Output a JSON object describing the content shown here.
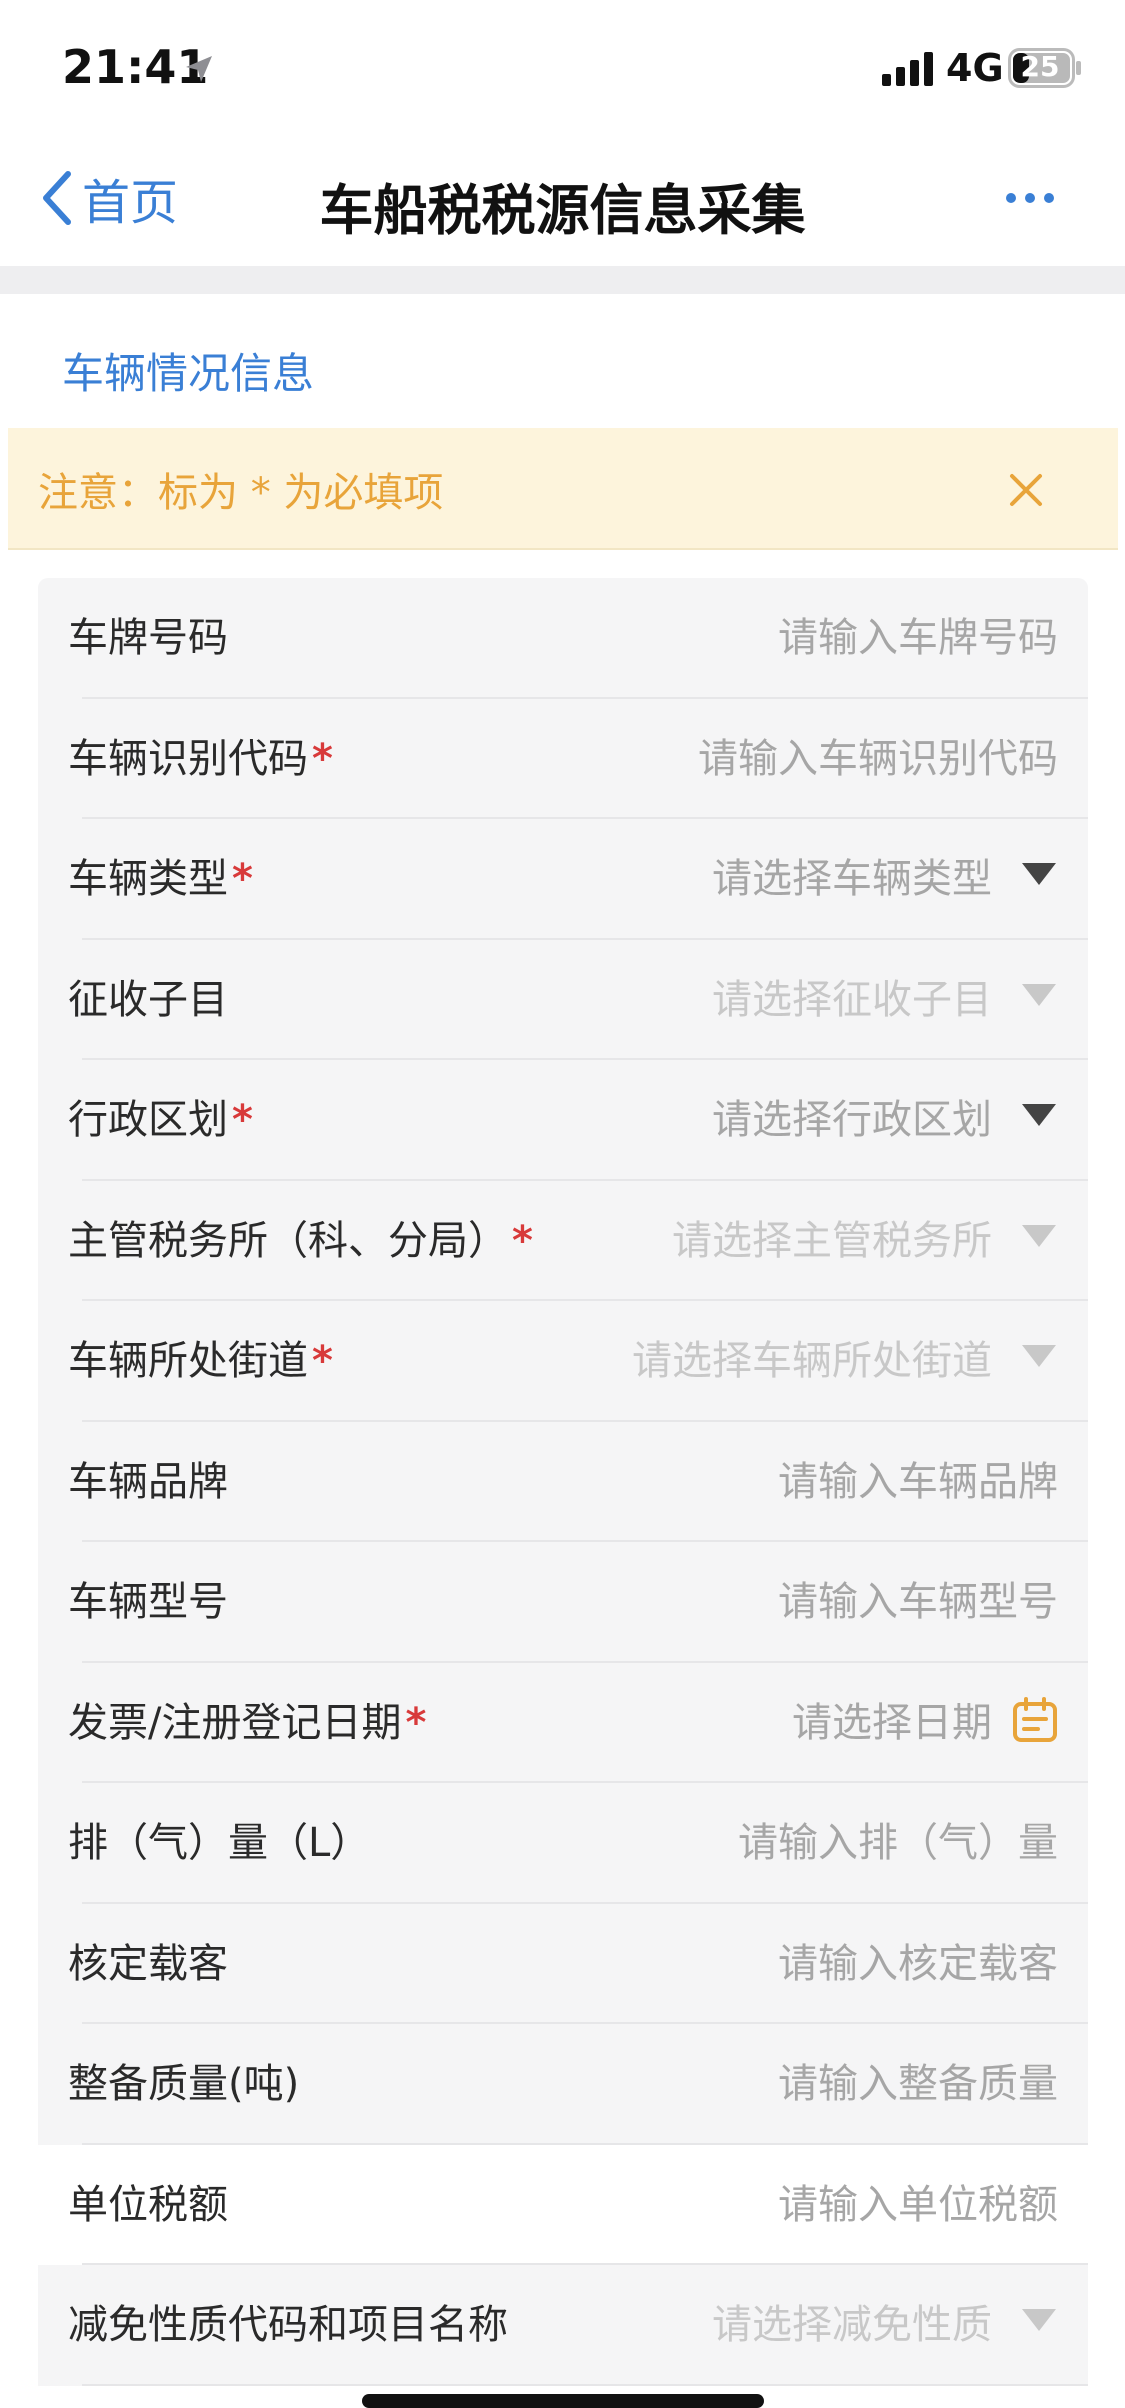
{
  "status_bar": {
    "time": "21:41",
    "network": "4G",
    "battery": "25"
  },
  "nav": {
    "back_label": "首页",
    "title": "车船税税源信息采集"
  },
  "section": {
    "title": "车辆情况信息"
  },
  "notice": {
    "text": "注意：标为 * 为必填项"
  },
  "colors": {
    "accent": "#3a7fd5",
    "warning": "#e8a43a",
    "required": "#d83a3a"
  },
  "required_mark": "*",
  "form": {
    "rows": [
      {
        "label": "车牌号码",
        "required": false,
        "placeholder": "请输入车牌号码",
        "kind": "input"
      },
      {
        "label": "车辆识别代码",
        "required": true,
        "placeholder": "请输入车辆识别代码",
        "kind": "input"
      },
      {
        "label": "车辆类型",
        "required": true,
        "placeholder": "请选择车辆类型",
        "kind": "select"
      },
      {
        "label": "征收子目",
        "required": false,
        "placeholder": "请选择征收子目",
        "kind": "select-disabled"
      },
      {
        "label": "行政区划",
        "required": true,
        "placeholder": "请选择行政区划",
        "kind": "select"
      },
      {
        "label": "主管税务所（科、分局）",
        "required": true,
        "placeholder": "请选择主管税务所",
        "kind": "select-disabled"
      },
      {
        "label": "车辆所处街道",
        "required": true,
        "placeholder": "请选择车辆所处街道",
        "kind": "select-disabled"
      },
      {
        "label": "车辆品牌",
        "required": false,
        "placeholder": "请输入车辆品牌",
        "kind": "input"
      },
      {
        "label": "车辆型号",
        "required": false,
        "placeholder": "请输入车辆型号",
        "kind": "input"
      },
      {
        "label": "发票/注册登记日期",
        "required": true,
        "placeholder": "请选择日期",
        "kind": "date"
      },
      {
        "label": "排（气）量（L）",
        "required": false,
        "placeholder": "请输入排（气）量",
        "kind": "input"
      },
      {
        "label": "核定载客",
        "required": false,
        "placeholder": "请输入核定载客",
        "kind": "input"
      },
      {
        "label": "整备质量(吨)",
        "required": false,
        "placeholder": "请输入整备质量",
        "kind": "input"
      },
      {
        "label": "单位税额",
        "required": false,
        "placeholder": "请输入单位税额",
        "kind": "input-white"
      },
      {
        "label": "减免性质代码和项目名称",
        "required": false,
        "placeholder": "请选择减免性质",
        "kind": "select-disabled"
      }
    ]
  }
}
